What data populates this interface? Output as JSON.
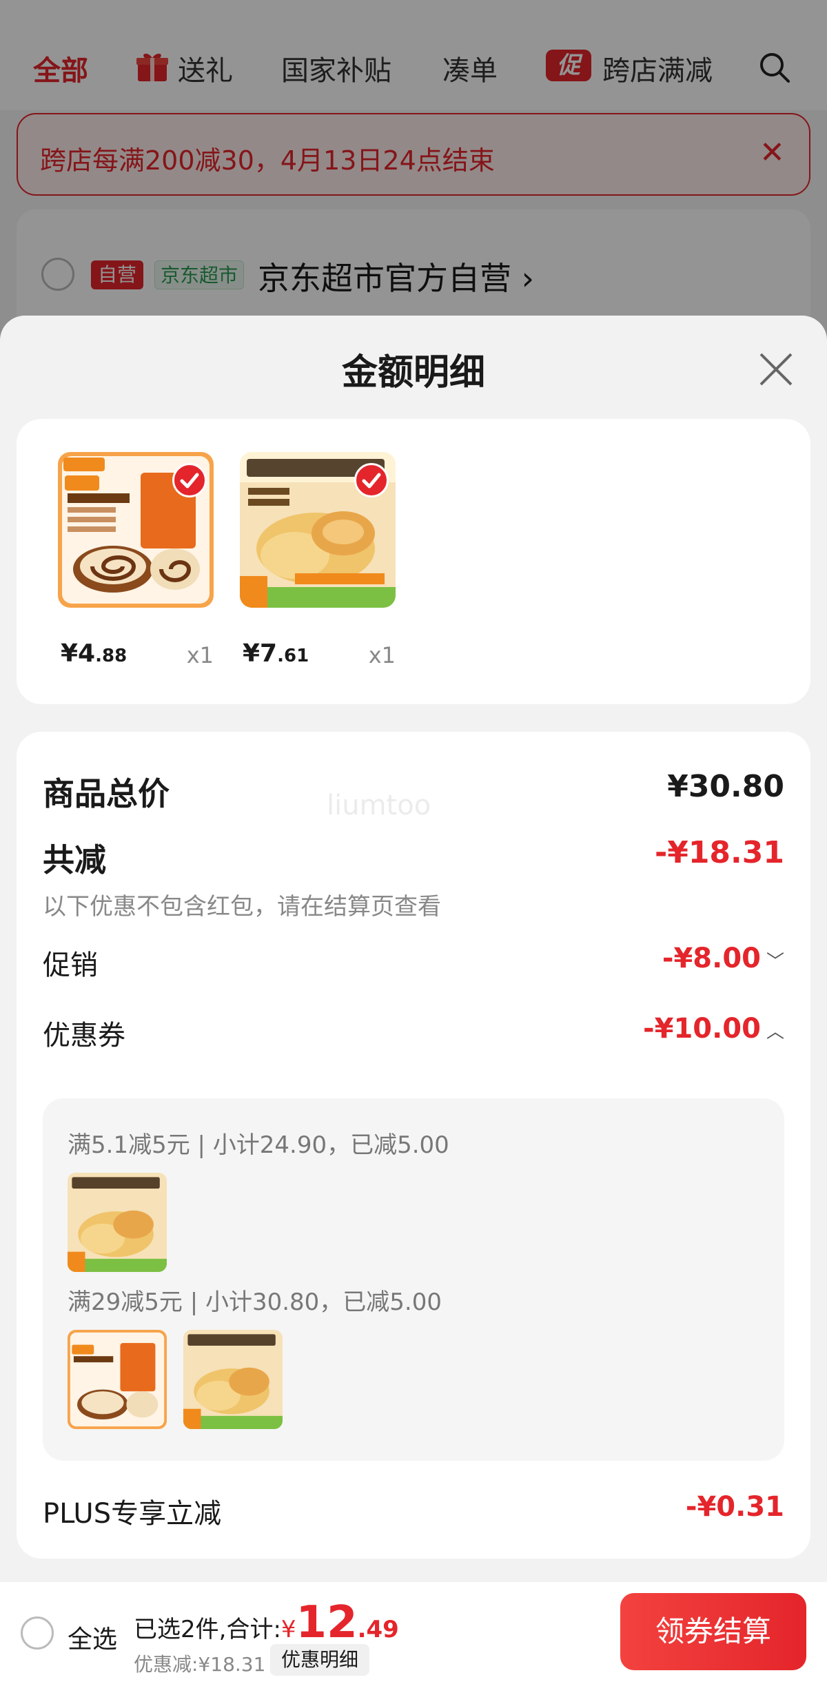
{
  "background": {
    "tabs": [
      {
        "label": "全部",
        "active": true
      },
      {
        "label": "送礼",
        "icon": "gift-icon"
      },
      {
        "label": "国家补贴"
      },
      {
        "label": "凑单"
      },
      {
        "label": "跨店满减",
        "icon": "promo-icon",
        "icon_text": "促"
      }
    ],
    "notice_text": "跨店每满200减30，4月13日24点结束",
    "shop": {
      "badge_self": "自营",
      "badge_jd": "京东超市",
      "name": "京东超市官方自营 ›"
    }
  },
  "sheet": {
    "title": "金额明细",
    "products": [
      {
        "price_int": "¥4",
        "price_dec": ".88",
        "qty": "x1",
        "thumb": "swiss-roll"
      },
      {
        "price_int": "¥7",
        "price_dec": ".61",
        "qty": "x1",
        "thumb": "meat-floss-pastry"
      }
    ],
    "watermark": "liumtoo",
    "total_label": "商品总价",
    "total_value": "¥30.80",
    "reduce_label": "共减",
    "reduce_value": "-¥18.31",
    "reduce_note": "以下优惠不包含红包，请在结算页查看",
    "promo_label": "促销",
    "promo_value": "-¥8.00",
    "coupon_label": "优惠券",
    "coupon_value": "-¥10.00",
    "coupons": [
      {
        "line": "满5.1减5元 | 小计24.90，已减5.00"
      },
      {
        "line": "满29减5元 | 小计30.80，已减5.00"
      }
    ],
    "plus_label": "PLUS专享立减",
    "plus_value": "-¥0.31"
  },
  "bottom": {
    "select_all": "全选",
    "total_prefix": "已选2件,合计:",
    "currency": "¥",
    "total_int": "12",
    "total_dec": ".49",
    "discount_text": "优惠减:¥18.31",
    "discount_detail_btn": "优惠明细",
    "checkout_btn": "领券结算"
  },
  "colors": {
    "accent": "#e4252b",
    "green": "#2a9a52",
    "muted": "#888888"
  }
}
